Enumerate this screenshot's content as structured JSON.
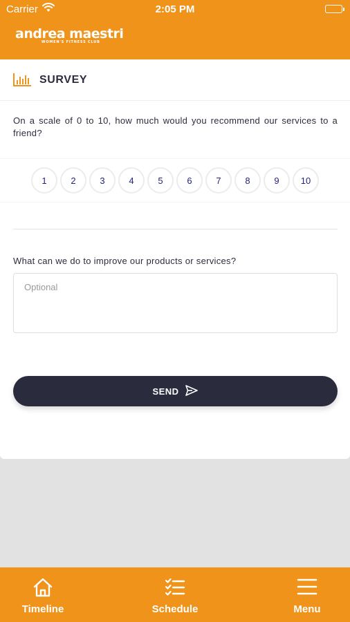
{
  "status_bar": {
    "carrier": "Carrier",
    "time": "2:05 PM"
  },
  "header": {
    "logo_name": "andrea maestri",
    "logo_subtitle": "WOMEN'S FITNESS CLUB",
    "background_color": "#f0931a"
  },
  "survey": {
    "title": "SURVEY",
    "title_icon": "bar-chart-icon",
    "question1": "On a scale of 0 to 10, how much would you recommend our services to a friend?",
    "scale": [
      "1",
      "2",
      "3",
      "4",
      "5",
      "6",
      "7",
      "8",
      "9",
      "10"
    ],
    "question2": "What can we do to improve our products or services?",
    "feedback_placeholder": "Optional",
    "feedback_value": "",
    "send_label": "SEND",
    "send_icon": "send-icon",
    "send_color": "#2b2b3e"
  },
  "tab_bar": {
    "items": [
      {
        "label": "Timeline",
        "icon": "home-icon"
      },
      {
        "label": "Schedule",
        "icon": "checklist-icon"
      },
      {
        "label": "Menu",
        "icon": "hamburger-menu-icon"
      }
    ]
  }
}
